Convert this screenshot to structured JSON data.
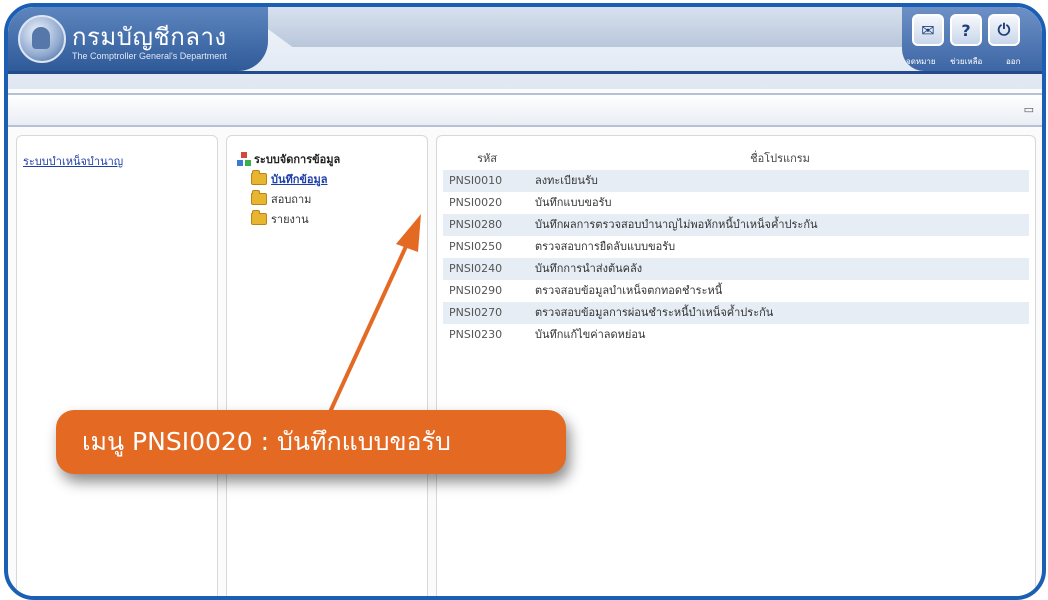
{
  "header": {
    "title": "กรมบัญชีกลาง",
    "subtitle": "The Comptroller General's Department",
    "buttons": [
      {
        "label": "จดหมาย",
        "icon": "mail-icon",
        "glyph": "✉"
      },
      {
        "label": "ช่วยเหลือ",
        "icon": "help-icon",
        "glyph": "?"
      },
      {
        "label": "ออก",
        "icon": "exit-icon",
        "glyph": "⏻"
      }
    ]
  },
  "left_panel": {
    "link": "ระบบบำเหน็จบำนาญ"
  },
  "tree": {
    "root": "ระบบจัดการข้อมูล",
    "items": [
      "บันทึกข้อมูล",
      "สอบถาม",
      "รายงาน"
    ]
  },
  "table": {
    "col_code": "รหัส",
    "col_name": "ชื่อโปรแกรม",
    "rows": [
      {
        "code": "PNSI0010",
        "name": "ลงทะเบียนรับ"
      },
      {
        "code": "PNSI0020",
        "name": "บันทึกแบบขอรับ"
      },
      {
        "code": "PNSI0280",
        "name": "บันทึกผลการตรวจสอบบำนาญไม่พอหักหนี้บำเหน็จค้ำประกัน"
      },
      {
        "code": "PNSI0250",
        "name": "ตรวจสอบการยืดลับแบบขอรับ"
      },
      {
        "code": "PNSI0240",
        "name": "บันทึกการนำส่งต้นคลัง"
      },
      {
        "code": "PNSI0290",
        "name": "ตรวจสอบข้อมูลบำเหน็จตกทอดชำระหนี้"
      },
      {
        "code": "PNSI0270",
        "name": "ตรวจสอบข้อมูลการผ่อนชำระหนี้บำเหน็จค้ำประกัน"
      },
      {
        "code": "PNSI0230",
        "name": "บันทึกแก้ไขค่าลดหย่อน"
      }
    ]
  },
  "callout": {
    "text": "เมนู PNSI0020 : บันทึกแบบขอรับ"
  },
  "colors": {
    "frame": "#1a5fb4",
    "header": "#3d66a5",
    "callout": "#e46a24",
    "link": "#1f3fa8"
  }
}
